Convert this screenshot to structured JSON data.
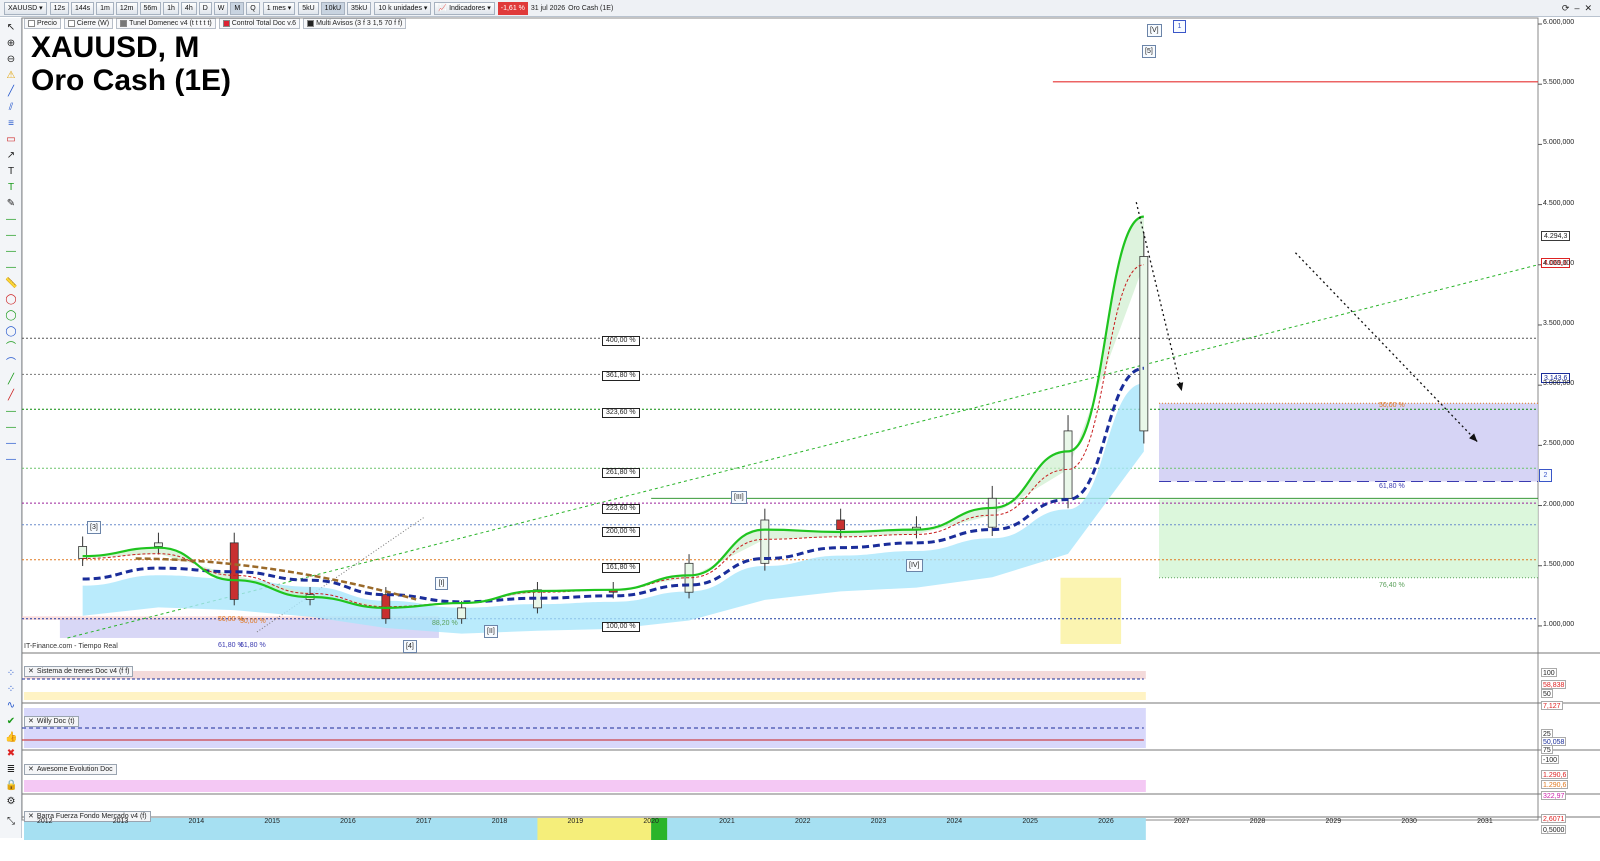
{
  "toolbar": {
    "symbol": "XAUUSD",
    "timeframes": [
      "12s",
      "144s",
      "1m",
      "12m",
      "56m",
      "1h",
      "4h",
      "D",
      "W",
      "M",
      "Q"
    ],
    "active_timeframe": "M",
    "period": "1 mes",
    "units": [
      "5kU",
      "10kU",
      "35kU"
    ],
    "units_select": "10 k unidades",
    "indicators_label": "Indicadores",
    "change": "-1,61 %",
    "date": "31 jul 2026",
    "instrument_name": "Oro Cash (1E)"
  },
  "legend": {
    "items": [
      "Precio",
      "Cierre (W)",
      "Tunel Domenec v4 (t t t t t)",
      "Control Total Doc v.6",
      "Multi Avisos (3 f 3 1,5 70 f f)"
    ]
  },
  "title": {
    "line1": "XAUUSD, M",
    "line2": "Oro Cash (1E)"
  },
  "source": "IT-Finance.com - Tiempo Real",
  "panels": {
    "trend": "Sistema de trenes Doc v4 (f f)",
    "willy": "Willy Doc (t)",
    "awesome": "Awesome Evolution Doc",
    "fuerza": "Barra Fuerza Fondo Mercado v4 (f)"
  },
  "fib_labels": [
    {
      "text": "400,00 %",
      "color": "#555555"
    },
    {
      "text": "361,80 %",
      "color": "#777777"
    },
    {
      "text": "323,60 %",
      "color": "#0a8a0a"
    },
    {
      "text": "261,80 %",
      "color": "#6ac46a"
    },
    {
      "text": "223,60 %",
      "color": "#9a209a"
    },
    {
      "text": "200,00 %",
      "color": "#6a8ccc"
    },
    {
      "text": "161,80 %",
      "color": "#e07820"
    },
    {
      "text": "100,00 %",
      "color": "#1a3aa0"
    }
  ],
  "zone_labels": {
    "z50": "50,00 %",
    "z618": "61,80 %",
    "z764": "76,40 %"
  },
  "misc_labels": {
    "low_50": "50,00 %",
    "low_50b": "50,00 %",
    "low_618": "61,80 %",
    "low_618b": "61,80 %",
    "low_882": "88,20 %"
  },
  "wave_labels": {
    "w3": "[3]",
    "w4": "[4]",
    "wI": "[I]",
    "wII": "[II]",
    "wIII": "[III]",
    "wIV": "[IV]",
    "wV": "[V]",
    "w5": "[5]",
    "w1": "1",
    "w2": "2"
  },
  "price_tags": {
    "current_a": "4.294,3",
    "current_b": "4.069,6",
    "target": "3.143,6"
  },
  "osc_values": {
    "trend": [
      "100",
      "58,838",
      "50",
      "7,127",
      "0"
    ],
    "willy": [
      "25",
      "50,058",
      "75",
      "-100"
    ],
    "awesome": [
      "1.290,6",
      "1.290,6",
      "322,97",
      "0"
    ],
    "fuerza": [
      "2,6071",
      "0,5000"
    ]
  },
  "colors": {
    "ema_fast": "#1fc41f",
    "ema_slow_red": "#c81e1e",
    "ema_long_blue": "#1a2d9a",
    "resistance": "#e63030",
    "zone_purple": "#c8c6f2",
    "zone_green": "#d3f5d3"
  },
  "chart_data": {
    "type": "candlestick",
    "title": "XAUUSD, M",
    "subtitle": "Oro Cash (1E)",
    "x": [
      "2012",
      "2013",
      "2014",
      "2015",
      "2016",
      "2017",
      "2018",
      "2019",
      "2020",
      "2021",
      "2022",
      "2023",
      "2024",
      "2025",
      "2026"
    ],
    "x_ticks": [
      "2012",
      "2013",
      "2014",
      "2015",
      "2016",
      "2017",
      "2018",
      "2019",
      "2020",
      "2021",
      "2022",
      "2023",
      "2024",
      "2025",
      "2026",
      "2027",
      "2028",
      "2029",
      "2030",
      "2031"
    ],
    "series": [
      {
        "name": "Precio",
        "close": [
          1660,
          1690,
          1220,
          1260,
          1060,
          1150,
          1300,
          1280,
          1520,
          1880,
          1800,
          1820,
          2060,
          2620,
          4069
        ]
      },
      {
        "values": [
          1580,
          1650,
          1380,
          1240,
          1150,
          1190,
          1290,
          1300,
          1420,
          1800,
          1780,
          1800,
          1980,
          2450,
          4400
        ]
      },
      {
        "values": [
          1560,
          1600,
          1420,
          1270,
          1160,
          1190,
          1280,
          1300,
          1400,
          1720,
          1740,
          1760,
          1920,
          2300,
          4000
        ]
      },
      {
        "values": [
          1390,
          1480,
          1450,
          1380,
          1260,
          1200,
          1230,
          1250,
          1340,
          1560,
          1650,
          1690,
          1800,
          2050,
          3140
        ]
      }
    ],
    "y_ticks": [
      1000,
      1500,
      2000,
      2500,
      3000,
      3500,
      4000,
      4500,
      5000,
      5500,
      6000
    ],
    "ylim": [
      800,
      6050
    ],
    "xlim": [
      2011.7,
      2031.7
    ],
    "resistance": 5520,
    "fib_levels": [
      3390,
      3090,
      2800,
      2310,
      2020,
      1840,
      1550,
      1060
    ],
    "zones": {
      "projection_purple": [
        2200,
        2850
      ],
      "projection_green": [
        1400,
        2050
      ],
      "z50": 2850,
      "z618": 2200,
      "z764": 1400
    }
  }
}
